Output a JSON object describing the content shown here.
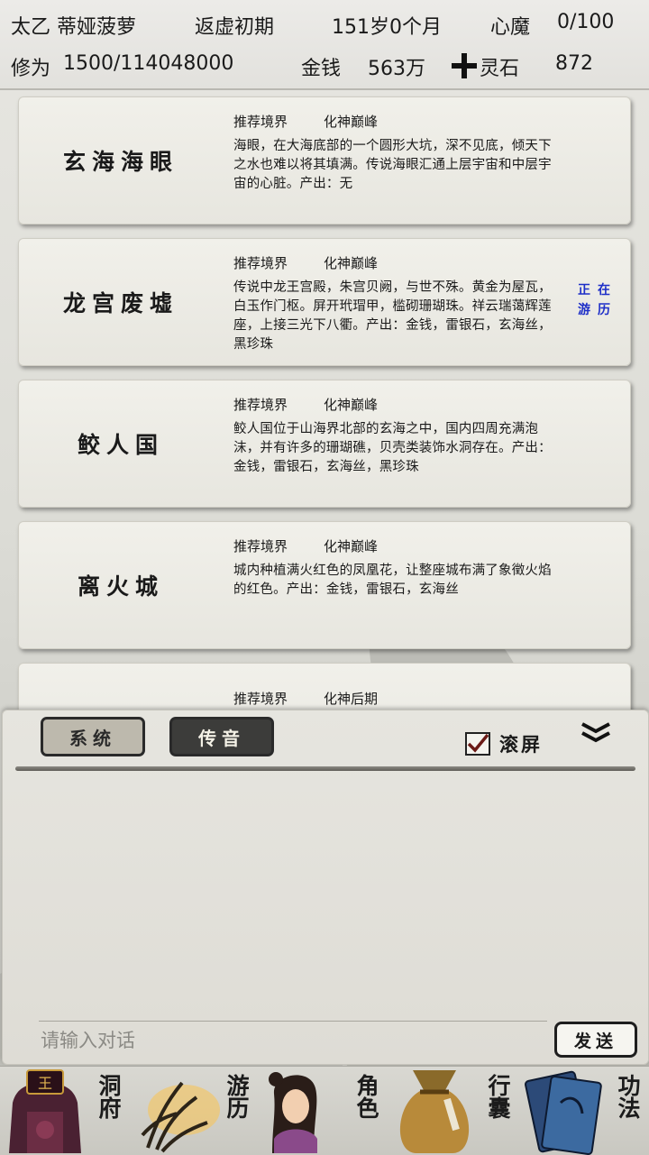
{
  "header": {
    "character_name": "太乙 蒂娅菠萝",
    "realm": "返虚初期",
    "age": "151岁0个月",
    "heart_demon_label": "心魔",
    "heart_demon_value": "0/100",
    "cultivation_label": "修为",
    "cultivation_value": "1500/114048000",
    "money_label": "金钱",
    "money_value": "563万",
    "spirit_stone_label": "灵石",
    "spirit_stone_value": "872"
  },
  "locations": [
    {
      "name": "玄海海眼",
      "recommend_label": "推荐境界",
      "recommend_value": "化神巅峰",
      "description": "海眼，在大海底部的一个圆形大坑，深不见底，倾天下之水也难以将其填满。传说海眼汇通上层宇宙和中层宇宙的心脏。产出：无",
      "status": ""
    },
    {
      "name": "龙宫废墟",
      "recommend_label": "推荐境界",
      "recommend_value": "化神巅峰",
      "description": "传说中龙王宫殿，朱宫贝阙，与世不殊。黄金为屋瓦，白玉作门枢。屏开玳瑁甲，槛砌珊瑚珠。祥云瑞蔼辉莲座，上接三光下八衢。产出：金钱，雷银石，玄海丝，黑珍珠",
      "status": "正在游历"
    },
    {
      "name": "鲛人国",
      "recommend_label": "推荐境界",
      "recommend_value": "化神巅峰",
      "description": "鲛人国位于山海界北部的玄海之中，国内四周充满泡沫，并有许多的珊瑚礁，贝壳类装饰水洞存在。产出：金钱，雷银石，玄海丝，黑珍珠",
      "status": ""
    },
    {
      "name": "离火城",
      "recommend_label": "推荐境界",
      "recommend_value": "化神巅峰",
      "description": "城内种植满火红色的凤凰花，让整座城布满了象徵火焰的红色。产出：金钱，雷银石，玄海丝",
      "status": ""
    },
    {
      "name": "",
      "recommend_label": "推荐境界",
      "recommend_value": "化神后期",
      "description": "",
      "status": ""
    }
  ],
  "chat": {
    "tab_system": "系统",
    "tab_whisper": "传音",
    "scroll_label": "滚屏",
    "scroll_checked": true,
    "input_placeholder": "请输入对话",
    "send_label": "发送"
  },
  "nav": [
    {
      "label": "洞府",
      "icon": "cave-mansion-icon"
    },
    {
      "label": "游历",
      "icon": "travel-icon"
    },
    {
      "label": "角色",
      "icon": "character-icon"
    },
    {
      "label": "行囊",
      "icon": "bag-icon"
    },
    {
      "label": "功法",
      "icon": "technique-book-icon"
    }
  ]
}
